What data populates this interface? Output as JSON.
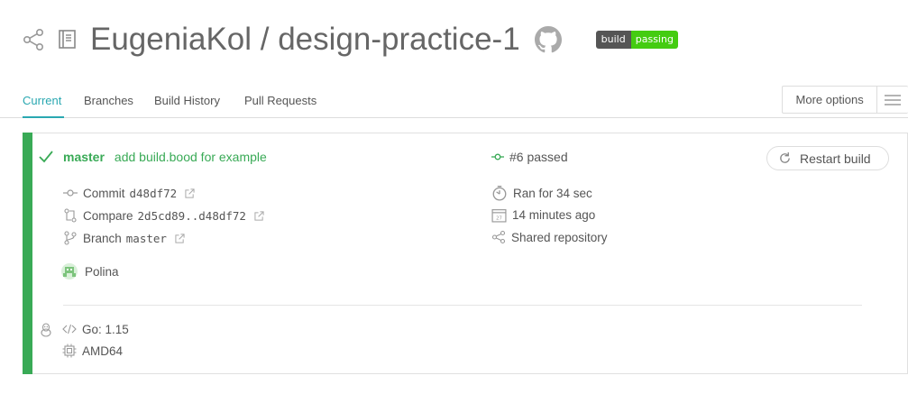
{
  "header": {
    "repo_title": "EugeniaKol / design-practice-1",
    "badge_left": "build",
    "badge_right": "passing"
  },
  "tabs": [
    {
      "label": "Current",
      "active": true
    },
    {
      "label": "Branches"
    },
    {
      "label": "Build History"
    },
    {
      "label": "Pull Requests"
    }
  ],
  "more_options": "More options",
  "build": {
    "branch": "master",
    "message": "add build.bood for example",
    "number_status": "#6 passed",
    "restart_label": "Restart build",
    "commit_label": "Commit",
    "commit_hash": "d48df72",
    "compare_label": "Compare",
    "compare_range": "2d5cd89..d48df72",
    "branch_label": "Branch",
    "branch_name": "master",
    "author": "Polina",
    "duration": "Ran for 34 sec",
    "time_ago": "14 minutes ago",
    "repo_type": "Shared repository",
    "language": "Go: 1.15",
    "arch": "AMD64"
  },
  "colors": {
    "accent": "#2aa8b1",
    "passed": "#39aa56",
    "badge_pass": "#44cc11",
    "badge_label": "#555555"
  }
}
